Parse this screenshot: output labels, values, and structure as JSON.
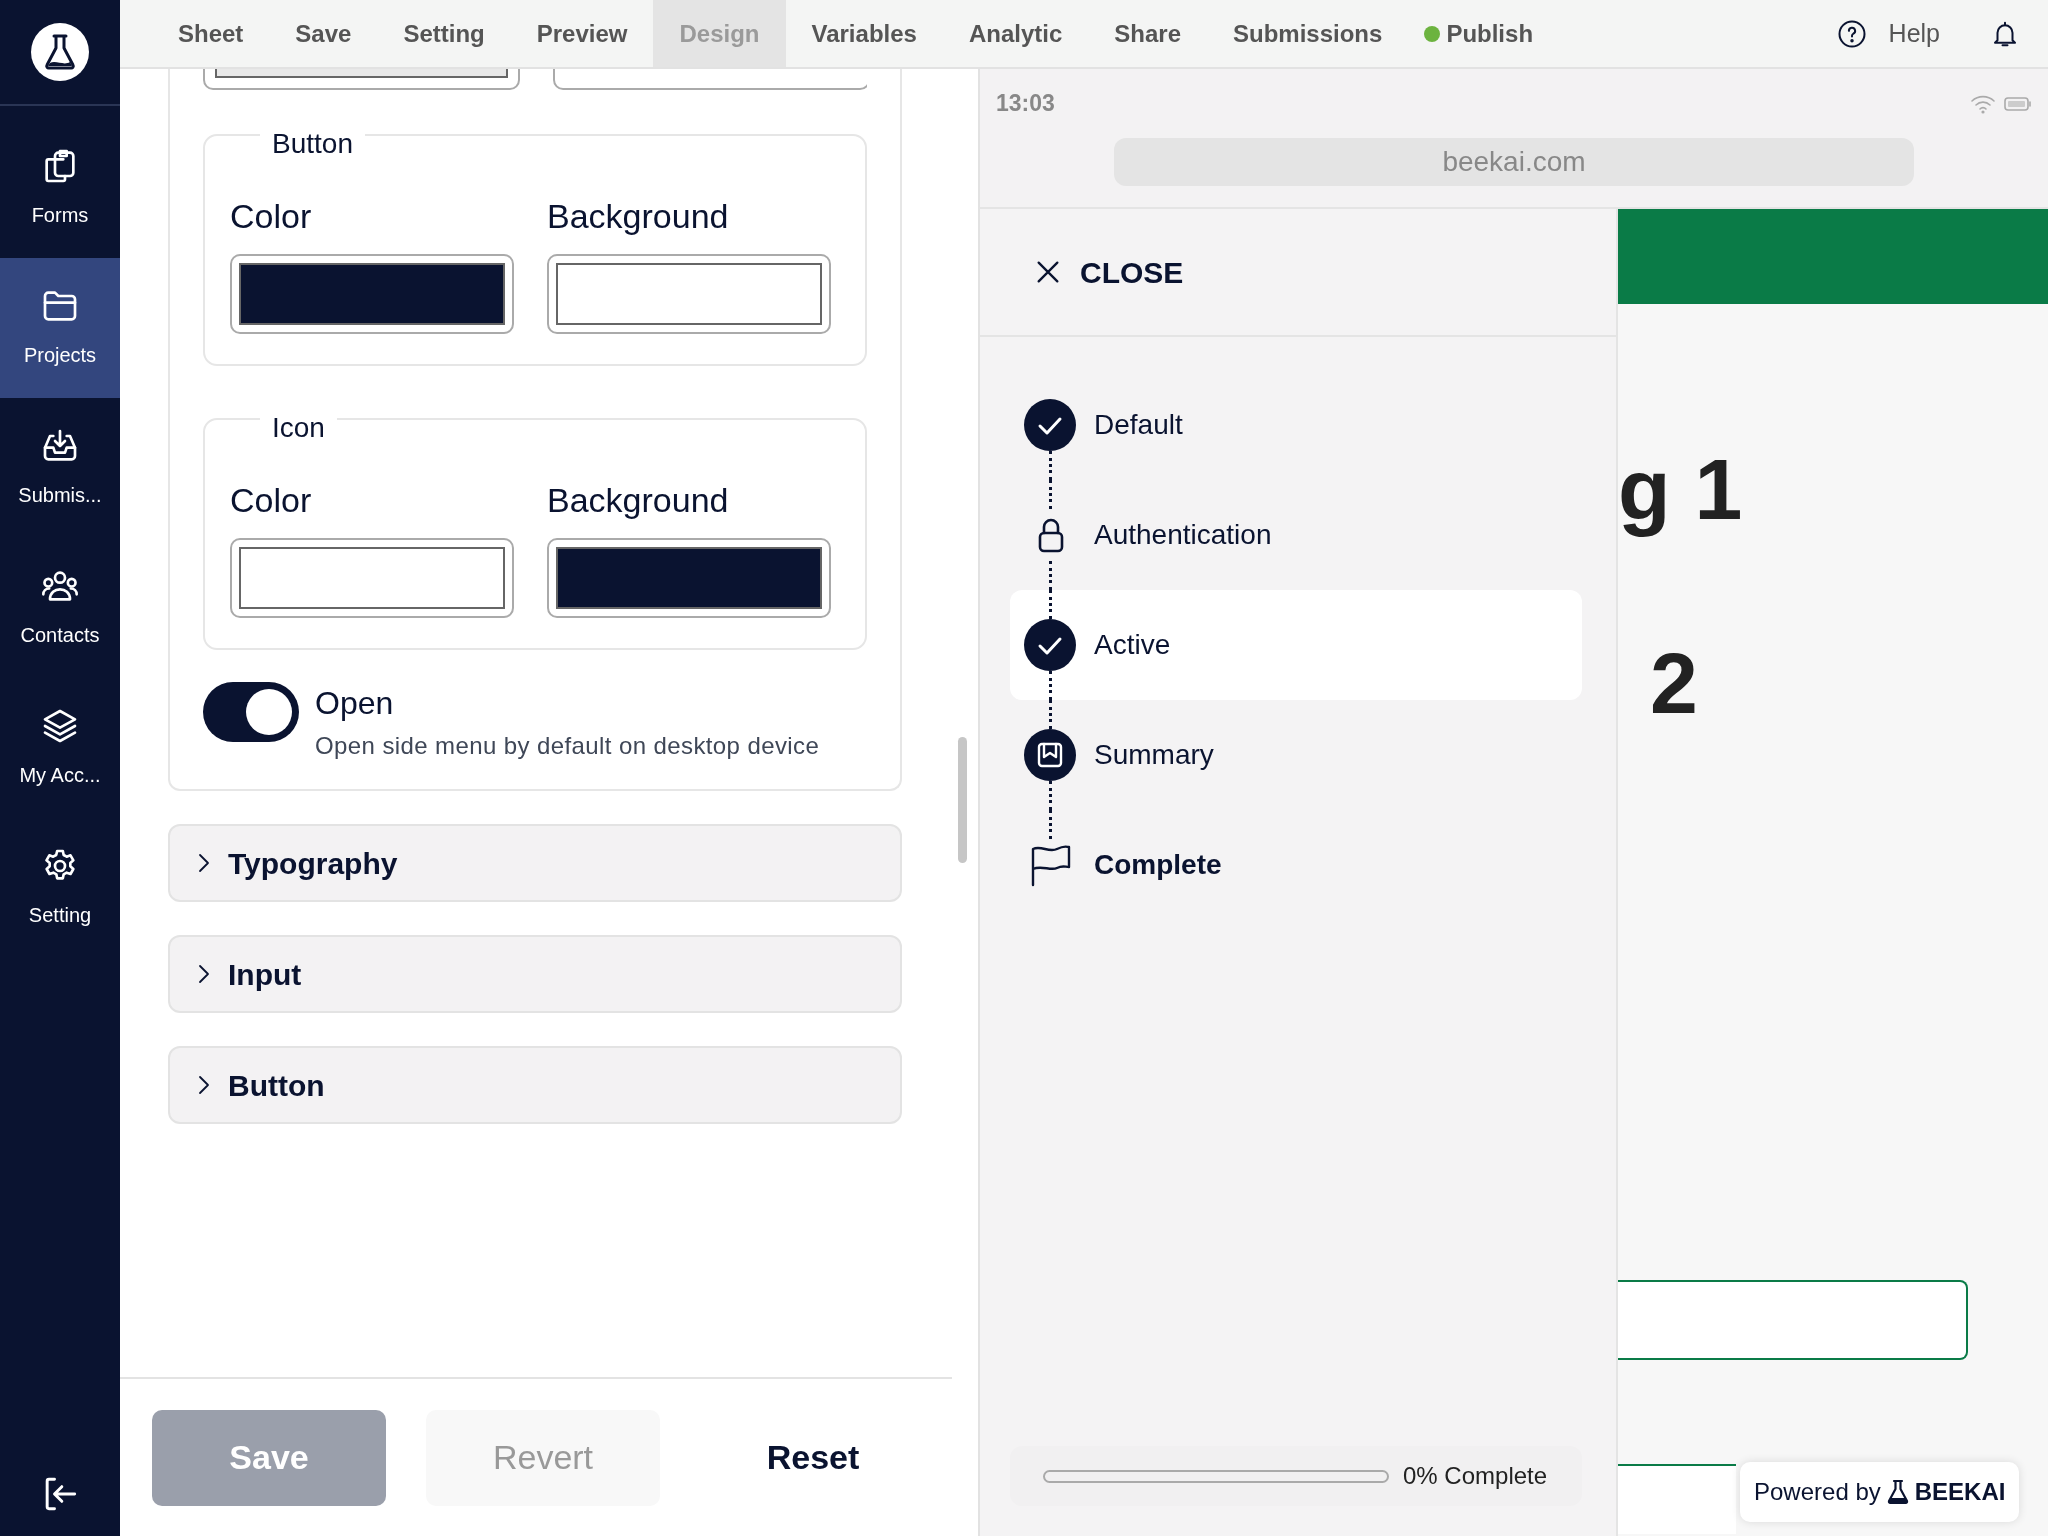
{
  "sidebar": {
    "items": [
      {
        "label": "Forms",
        "kind": "forms",
        "selected": false
      },
      {
        "label": "Projects",
        "kind": "projects",
        "selected": true
      },
      {
        "label": "Submis...",
        "kind": "submissions",
        "selected": false
      },
      {
        "label": "Contacts",
        "kind": "contacts",
        "selected": false
      },
      {
        "label": "My Acc...",
        "kind": "account",
        "selected": false
      },
      {
        "label": "Setting",
        "kind": "setting",
        "selected": false
      }
    ]
  },
  "menu": [
    {
      "label": "Sheet",
      "selected": false
    },
    {
      "label": "Save",
      "selected": false
    },
    {
      "label": "Setting",
      "selected": false
    },
    {
      "label": "Preview",
      "selected": false
    },
    {
      "label": "Design",
      "selected": true
    },
    {
      "label": "Variables",
      "selected": false
    },
    {
      "label": "Analytic",
      "selected": false
    },
    {
      "label": "Share",
      "selected": false
    },
    {
      "label": "Submissions",
      "selected": false
    },
    {
      "label": "Publish",
      "selected": false,
      "color": "#6cb33f"
    }
  ],
  "help": {
    "label": "Help"
  },
  "design": {
    "groups": [
      {
        "legend": "Button",
        "fields": [
          {
            "label": "Color",
            "color": "#0a1330"
          },
          {
            "label": "Background",
            "color": "#ffffff"
          }
        ]
      },
      {
        "legend": "Icon",
        "fields": [
          {
            "label": "Color",
            "color": "#ffffff"
          },
          {
            "label": "Background",
            "color": "#0a1330"
          }
        ]
      }
    ],
    "toggle": {
      "label": "Open",
      "description": "Open side menu by default on desktop device",
      "on": true
    },
    "sections": [
      {
        "label": "Typography",
        "expanded": false
      },
      {
        "label": "Input",
        "expanded": false
      },
      {
        "label": "Button",
        "expanded": false
      }
    ],
    "buttons": [
      {
        "label": "Save",
        "kind": "primary",
        "disabled": true
      },
      {
        "label": "Revert",
        "kind": "secondary",
        "disabled": true
      },
      {
        "label": "Reset",
        "kind": "plain",
        "disabled": false
      }
    ]
  },
  "preview": {
    "time": "13:03",
    "url": "beekai.com",
    "close_label": "CLOSE",
    "steps": [
      {
        "label": "Default",
        "kind": "done",
        "selected": false
      },
      {
        "label": "Authentication",
        "kind": "locked",
        "selected": false
      },
      {
        "label": "Active",
        "kind": "done",
        "selected": true
      },
      {
        "label": "Summary",
        "kind": "summary",
        "selected": false
      },
      {
        "label": "Complete",
        "kind": "finish",
        "selected": false
      }
    ],
    "progress": {
      "level": 0,
      "label": "0% Complete"
    },
    "headings": [
      "g 1",
      "2"
    ],
    "powered_by": {
      "label": "Powered by",
      "brand": "BEEKAI"
    }
  }
}
